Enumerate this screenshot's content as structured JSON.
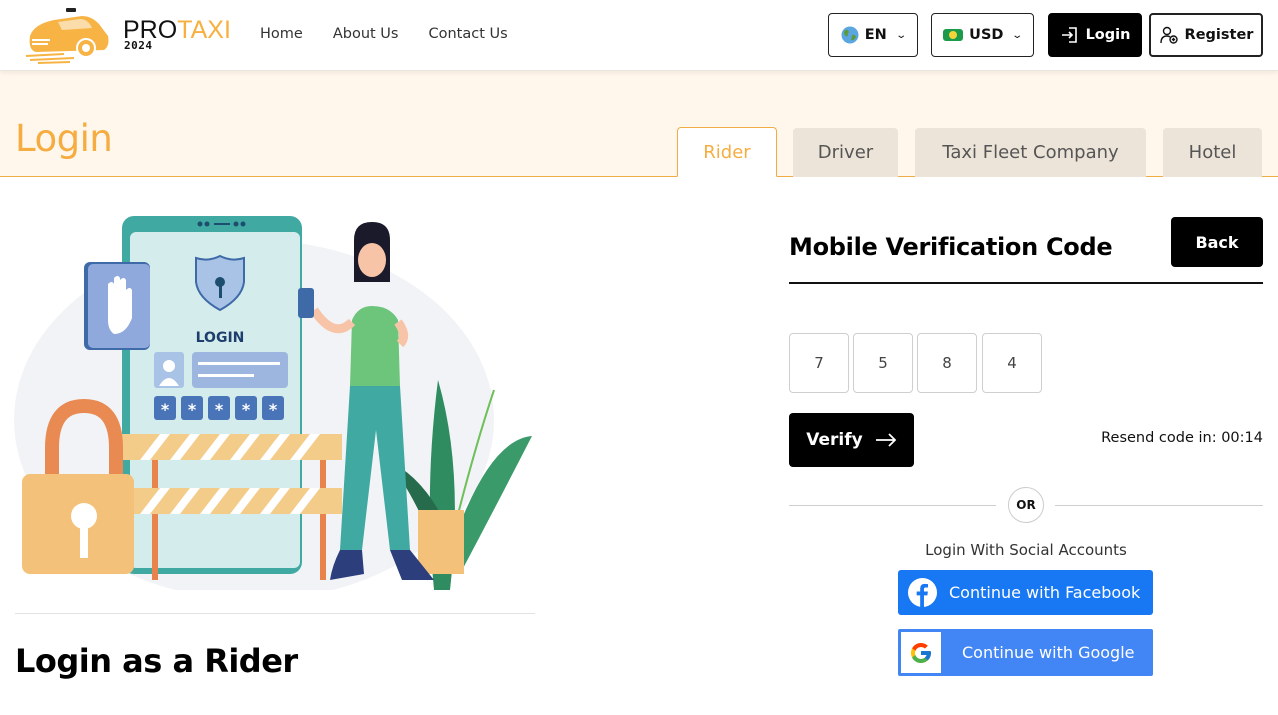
{
  "brand": {
    "name_part1": "PRO",
    "name_part2": "TAXI",
    "year": "2024",
    "accent_color": "#f5ad42"
  },
  "nav": {
    "items": [
      {
        "label": "Home"
      },
      {
        "label": "About Us"
      },
      {
        "label": "Contact Us"
      }
    ]
  },
  "header_actions": {
    "language": {
      "icon": "globe-icon",
      "value": "EN"
    },
    "currency": {
      "icon": "money-icon",
      "value": "USD"
    },
    "login_label": "Login",
    "register_label": "Register"
  },
  "hero": {
    "title": "Login",
    "tabs": [
      {
        "label": "Rider",
        "active": true
      },
      {
        "label": "Driver",
        "active": false
      },
      {
        "label": "Taxi Fleet Company",
        "active": false
      },
      {
        "label": "Hotel",
        "active": false
      }
    ]
  },
  "illustration": {
    "screen_text": "LOGIN",
    "alt": "login security illustration"
  },
  "left": {
    "heading": "Login as a Rider"
  },
  "form": {
    "title": "Mobile Verification Code",
    "back_label": "Back",
    "otp_digits": [
      "7",
      "5",
      "8",
      "4"
    ],
    "verify_label": "Verify",
    "resend_text": "Resend code in: 00:14",
    "or_text": "OR",
    "social_label": "Login With Social Accounts",
    "facebook_label": "Continue with Facebook",
    "google_label": "Continue with Google",
    "facebook_color": "#1877f2",
    "google_color": "#4285f4"
  }
}
